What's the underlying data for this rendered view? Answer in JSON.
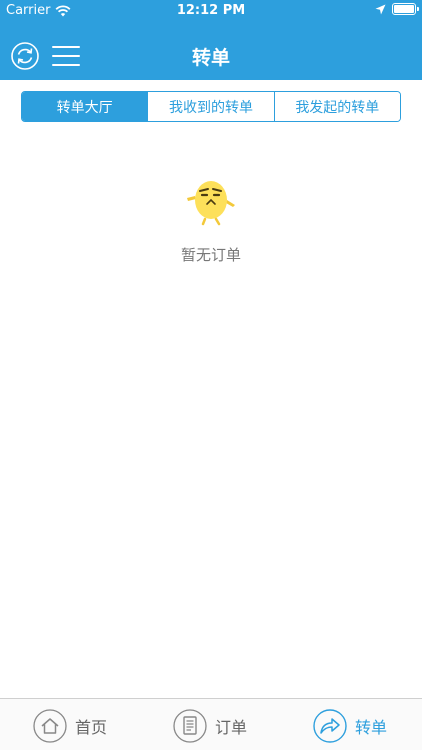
{
  "status_bar": {
    "carrier": "Carrier",
    "time": "12:12 PM"
  },
  "nav": {
    "title": "转单"
  },
  "segments": [
    {
      "label": "转单大厅",
      "active": true
    },
    {
      "label": "我收到的转单",
      "active": false
    },
    {
      "label": "我发起的转单",
      "active": false
    }
  ],
  "empty_state": {
    "message": "暂无订单"
  },
  "tabbar": {
    "items": [
      {
        "label": "首页",
        "icon": "home-icon",
        "active": false
      },
      {
        "label": "订单",
        "icon": "document-icon",
        "active": false
      },
      {
        "label": "转单",
        "icon": "forward-icon",
        "active": true
      }
    ]
  },
  "colors": {
    "primary": "#2d9fdd",
    "mascot": "#fde05a"
  }
}
